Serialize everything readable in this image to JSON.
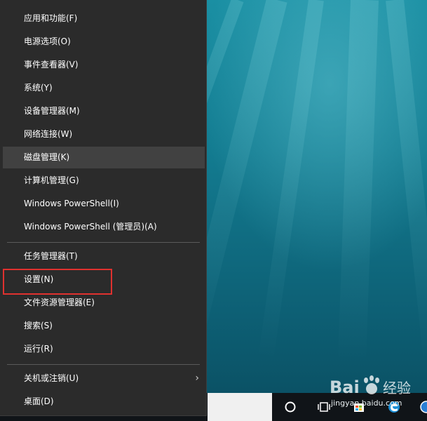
{
  "menu": {
    "items": [
      {
        "label": "应用和功能(F)"
      },
      {
        "label": "电源选项(O)"
      },
      {
        "label": "事件查看器(V)"
      },
      {
        "label": "系统(Y)"
      },
      {
        "label": "设备管理器(M)"
      },
      {
        "label": "网络连接(W)"
      },
      {
        "label": "磁盘管理(K)"
      },
      {
        "label": "计算机管理(G)"
      },
      {
        "label": "Windows PowerShell(I)"
      },
      {
        "label": "Windows PowerShell (管理员)(A)"
      },
      {
        "label": "任务管理器(T)"
      },
      {
        "label": "设置(N)"
      },
      {
        "label": "文件资源管理器(E)"
      },
      {
        "label": "搜索(S)"
      },
      {
        "label": "运行(R)"
      },
      {
        "label": "关机或注销(U)"
      },
      {
        "label": "桌面(D)"
      }
    ],
    "hovered_item": "磁盘管理(K)",
    "annotated_item": "设置(N)",
    "submenu_arrow_icon": "chevron-right-icon"
  },
  "watermark": {
    "brand": "Bai du 经验",
    "url": "jingyan.baidu.com"
  },
  "colors": {
    "menu_bg": "#2b2b2b",
    "hover_bg": "#414141",
    "highlight_border": "#e0312f",
    "wallpaper": "#137c91",
    "taskbar": "#101418"
  },
  "taskbar": {
    "icons": [
      "cortana-circle-icon",
      "task-view-icon",
      "store-icon",
      "edge-icon"
    ]
  }
}
